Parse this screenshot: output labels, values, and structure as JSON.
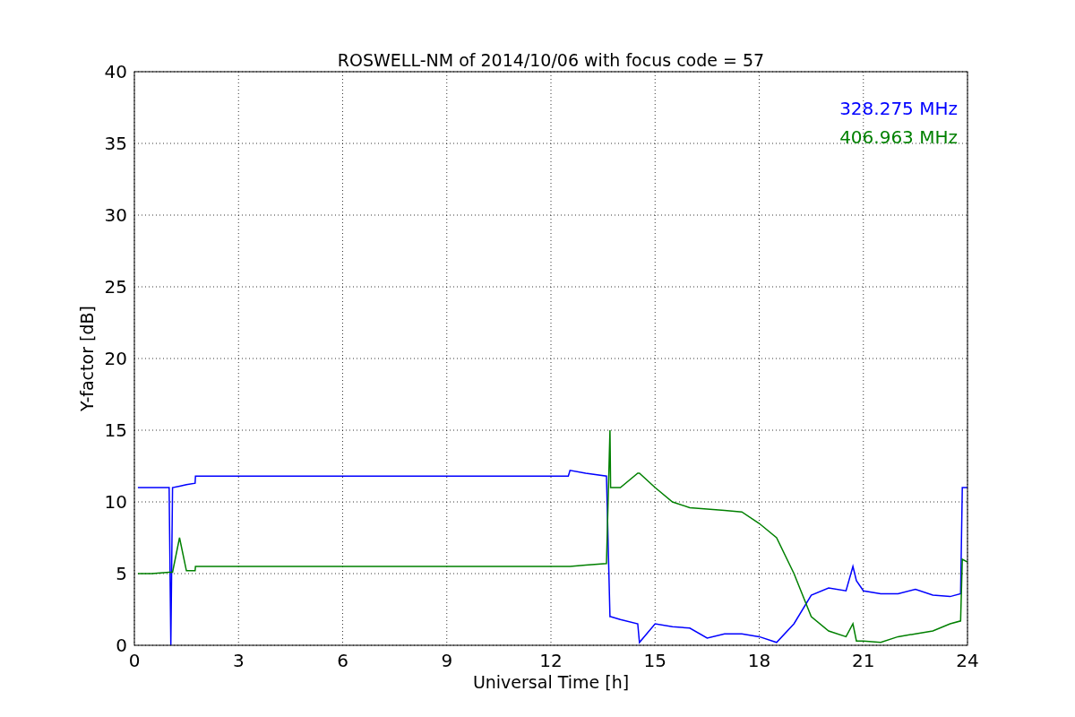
{
  "figure": {
    "chart_data": {
      "type": "line",
      "title": "ROSWELL-NM of 2014/10/06 with focus code = 57",
      "xlabel": "Universal Time [h]",
      "ylabel": "Y-factor [dB]",
      "x": [
        0.1,
        0.5,
        1.0,
        1.05,
        1.1,
        1.3,
        1.5,
        1.75,
        1.76,
        6,
        12,
        12.5,
        12.55,
        13,
        13.6,
        13.7,
        13.72,
        14,
        14.5,
        14.55,
        15,
        15.5,
        16,
        16.5,
        17,
        17.5,
        18,
        18.5,
        19,
        19.5,
        20,
        20.5,
        20.7,
        20.8,
        21,
        21.5,
        22,
        22.5,
        23,
        23.5,
        23.8,
        23.85,
        24
      ],
      "series": [
        {
          "name": "328.275 MHz",
          "color": "#0000ff",
          "values": [
            11,
            11,
            11,
            0,
            11,
            11.1,
            11.2,
            11.3,
            11.8,
            11.8,
            11.8,
            11.8,
            12.2,
            12,
            11.8,
            2,
            2,
            1.8,
            1.5,
            0.2,
            1.5,
            1.3,
            1.2,
            0.5,
            0.8,
            0.8,
            0.6,
            0.2,
            1.5,
            3.5,
            4,
            3.8,
            5.5,
            4.5,
            3.8,
            3.6,
            3.6,
            3.9,
            3.5,
            3.4,
            3.6,
            11,
            11
          ]
        },
        {
          "name": "406.963 MHz",
          "color": "#008000",
          "values": [
            5,
            5,
            5.1,
            5.1,
            5.1,
            7.5,
            5.2,
            5.2,
            5.5,
            5.5,
            5.5,
            5.5,
            5.5,
            5.6,
            5.7,
            15,
            11,
            11,
            12,
            12,
            11,
            10,
            9.6,
            9.5,
            9.4,
            9.3,
            8.5,
            7.5,
            5,
            2,
            1,
            0.6,
            1.5,
            0.3,
            0.3,
            0.2,
            0.6,
            0.8,
            1.0,
            1.5,
            1.7,
            6,
            5.8
          ]
        }
      ],
      "xlim": [
        0,
        24
      ],
      "ylim": [
        0,
        40
      ],
      "xticks": [
        0,
        3,
        6,
        9,
        12,
        15,
        18,
        21,
        24
      ],
      "yticks": [
        0,
        5,
        10,
        15,
        20,
        25,
        30,
        35,
        40
      ],
      "grid": true
    }
  }
}
